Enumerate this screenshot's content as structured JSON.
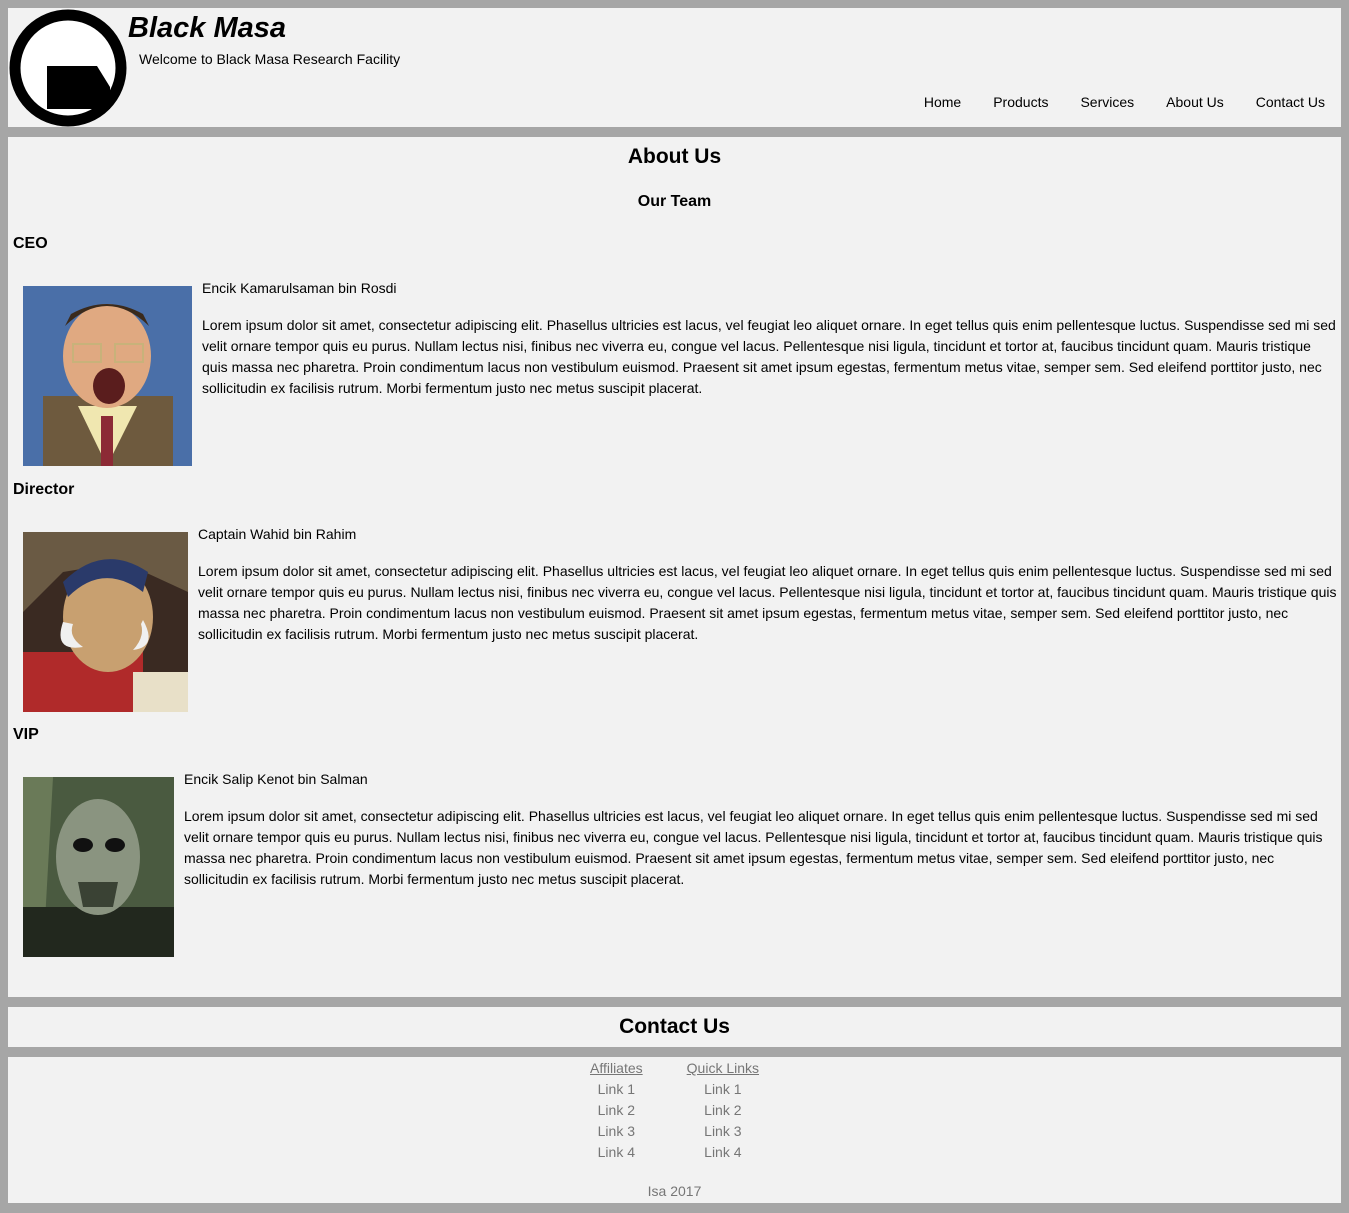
{
  "header": {
    "logo_name": "black-masa-logo",
    "title": "Black Masa",
    "tagline": "Welcome to Black Masa Research Facility",
    "nav": [
      "Home",
      "Products",
      "Services",
      "About Us",
      "Contact Us"
    ]
  },
  "main": {
    "page_title": "About Us",
    "team_title": "Our Team",
    "members": [
      {
        "role": "CEO",
        "name": "Encik Kamarulsaman bin Rosdi",
        "bio": "Lorem ipsum dolor sit amet, consectetur adipiscing elit. Phasellus ultricies est lacus, vel feugiat leo aliquet ornare. In eget tellus quis enim pellentesque luctus. Suspendisse sed mi sed velit ornare tempor quis eu purus. Nullam lectus nisi, finibus nec viverra eu, congue vel lacus. Pellentesque nisi ligula, tincidunt et tortor at, faucibus tincidunt quam. Mauris tristique quis massa nec pharetra. Proin condimentum lacus non vestibulum euismod. Praesent sit amet ipsum egestas, fermentum metus vitae, semper sem. Sed eleifend porttitor justo, nec sollicitudin ex facilisis rutrum. Morbi fermentum justo nec metus suscipit placerat."
      },
      {
        "role": "Director",
        "name": "Captain Wahid bin Rahim",
        "bio": "Lorem ipsum dolor sit amet, consectetur adipiscing elit. Phasellus ultricies est lacus, vel feugiat leo aliquet ornare. In eget tellus quis enim pellentesque luctus. Suspendisse sed mi sed velit ornare tempor quis eu purus. Nullam lectus nisi, finibus nec viverra eu, congue vel lacus. Pellentesque nisi ligula, tincidunt et tortor at, faucibus tincidunt quam. Mauris tristique quis massa nec pharetra. Proin condimentum lacus non vestibulum euismod. Praesent sit amet ipsum egestas, fermentum metus vitae, semper sem. Sed eleifend porttitor justo, nec sollicitudin ex facilisis rutrum. Morbi fermentum justo nec metus suscipit placerat."
      },
      {
        "role": "VIP",
        "name": "Encik Salip Kenot bin Salman",
        "bio": "Lorem ipsum dolor sit amet, consectetur adipiscing elit. Phasellus ultricies est lacus, vel feugiat leo aliquet ornare. In eget tellus quis enim pellentesque luctus. Suspendisse sed mi sed velit ornare tempor quis eu purus. Nullam lectus nisi, finibus nec viverra eu, congue vel lacus. Pellentesque nisi ligula, tincidunt et tortor at, faucibus tincidunt quam. Mauris tristique quis massa nec pharetra. Proin condimentum lacus non vestibulum euismod. Praesent sit amet ipsum egestas, fermentum metus vitae, semper sem. Sed eleifend porttitor justo, nec sollicitudin ex facilisis rutrum. Morbi fermentum justo nec metus suscipit placerat."
      }
    ]
  },
  "contact": {
    "title": "Contact Us"
  },
  "footer": {
    "columns": [
      {
        "title": "Affiliates",
        "links": [
          "Link 1",
          "Link 2",
          "Link 3",
          "Link 4"
        ]
      },
      {
        "title": "Quick Links",
        "links": [
          "Link 1",
          "Link 2",
          "Link 3",
          "Link 4"
        ]
      }
    ],
    "copyright": "Isa 2017"
  }
}
